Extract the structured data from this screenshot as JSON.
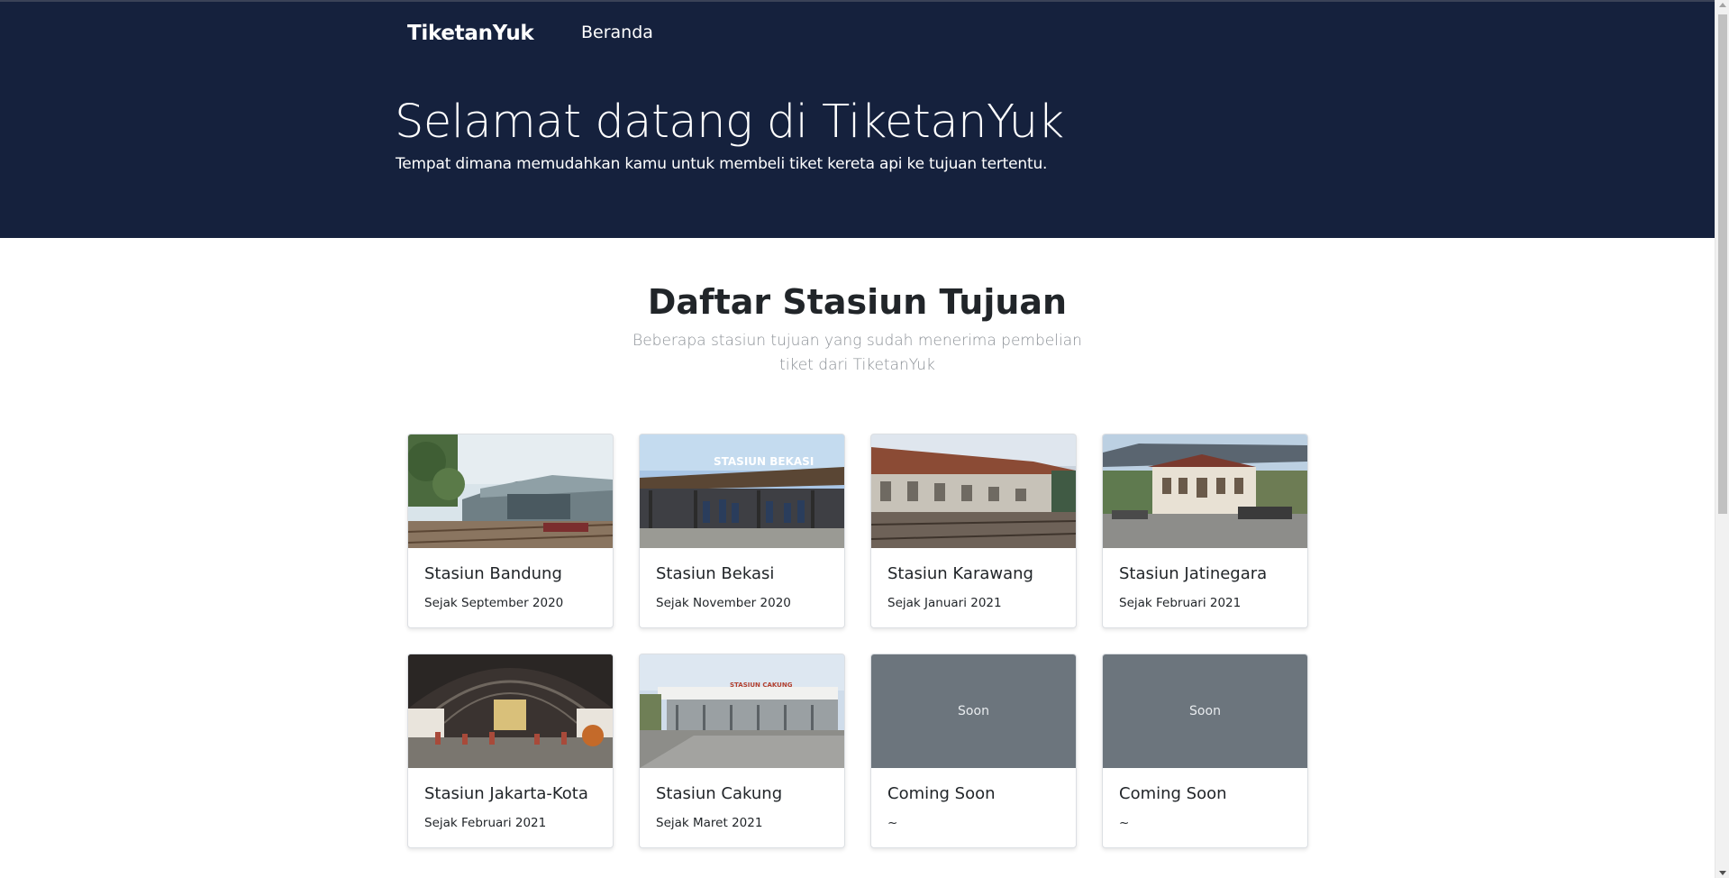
{
  "navbar": {
    "brand": "TiketanYuk",
    "links": [
      "Beranda"
    ]
  },
  "hero": {
    "title": "Selamat datang di TiketanYuk",
    "subtitle": "Tempat dimana memudahkan kamu untuk membeli tiket kereta api ke tujuan tertentu."
  },
  "section": {
    "title": "Daftar Stasiun Tujuan",
    "subtitle": "Beberapa stasiun tujuan yang sudah menerima pembelian tiket dari TiketanYuk"
  },
  "stations": [
    {
      "name": "Stasiun Bandung",
      "since": "Sejak September 2020",
      "image": "station-bandung-photo"
    },
    {
      "name": "Stasiun Bekasi",
      "since": "Sejak November 2020",
      "image": "station-bekasi-photo",
      "sign_text": "STASIUN BEKASI"
    },
    {
      "name": "Stasiun Karawang",
      "since": "Sejak Januari 2021",
      "image": "station-karawang-photo"
    },
    {
      "name": "Stasiun Jatinegara",
      "since": "Sejak Februari 2021",
      "image": "station-jatinegara-photo"
    },
    {
      "name": "Stasiun Jakarta-Kota",
      "since": "Sejak Februari 2021",
      "image": "station-jakarta-kota-photo"
    },
    {
      "name": "Stasiun Cakung",
      "since": "Sejak Maret 2021",
      "image": "station-cakung-photo",
      "sign_text": "STASIUN CAKUNG"
    },
    {
      "name": "Coming Soon",
      "since": "~",
      "image": "placeholder",
      "placeholder_text": "Soon"
    },
    {
      "name": "Coming Soon",
      "since": "~",
      "image": "placeholder",
      "placeholder_text": "Soon"
    }
  ],
  "colors": {
    "navbar_bg": "#15213d",
    "placeholder_bg": "#6c757d",
    "muted_text": "#8b9096"
  }
}
